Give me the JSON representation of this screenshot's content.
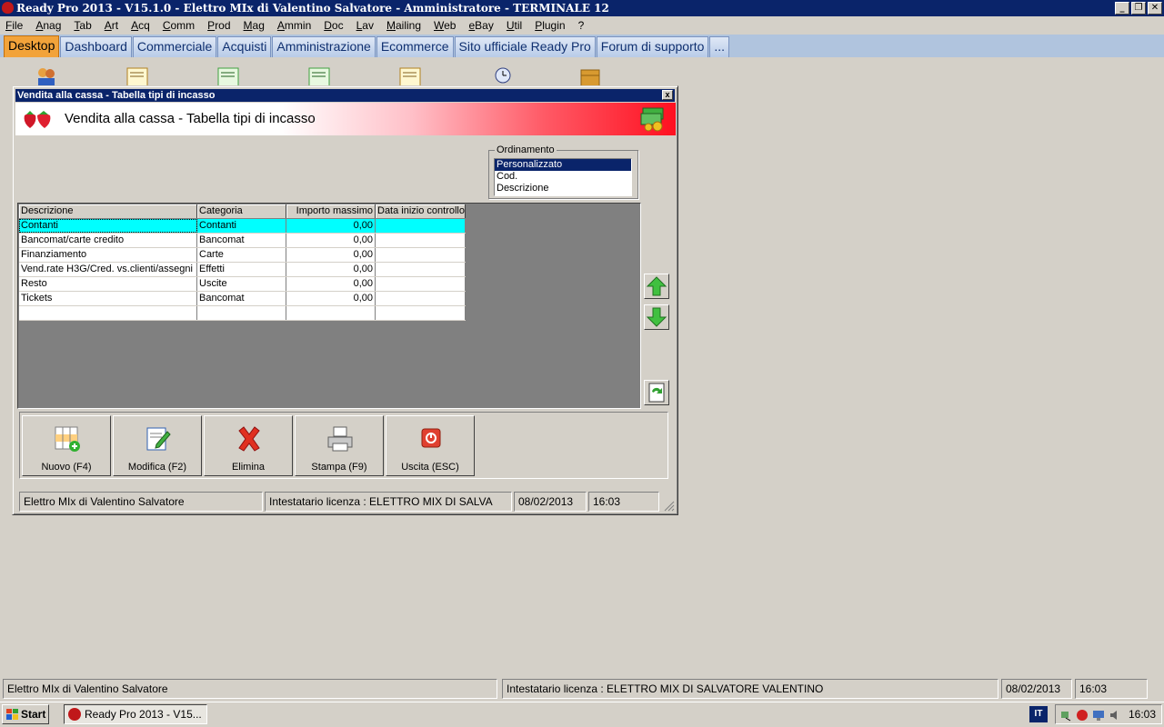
{
  "app": {
    "title": "Ready Pro 2013 - V15.1.0 - Elettro MIx di Valentino Salvatore - Amministratore - TERMINALE 12",
    "win_min": "_",
    "win_restore": "❐",
    "win_close": "✕"
  },
  "menu": [
    "File",
    "Anag",
    "Tab",
    "Art",
    "Acq",
    "Comm",
    "Prod",
    "Mag",
    "Ammin",
    "Doc",
    "Lav",
    "Mailing",
    "Web",
    "eBay",
    "Util",
    "Plugin",
    "?"
  ],
  "tabs": [
    {
      "label": "Desktop",
      "active": true
    },
    {
      "label": "Dashboard"
    },
    {
      "label": "Commerciale"
    },
    {
      "label": "Acquisti"
    },
    {
      "label": "Amministrazione"
    },
    {
      "label": "Ecommerce"
    },
    {
      "label": "Sito ufficiale Ready Pro"
    },
    {
      "label": "Forum di supporto"
    },
    {
      "label": "..."
    }
  ],
  "window": {
    "title": "Vendita alla cassa - Tabella tipi di incasso",
    "close": "x",
    "banner_title": "Vendita alla cassa - Tabella tipi di incasso"
  },
  "sort": {
    "legend": "Ordinamento",
    "options": [
      "Personalizzato",
      "Cod.",
      "Descrizione"
    ],
    "selected": 0
  },
  "grid": {
    "columns": [
      "Descrizione",
      "Categoria",
      "Importo massimo",
      "Data inizio controllo"
    ],
    "rows": [
      [
        "Contanti",
        "Contanti",
        "0,00",
        ""
      ],
      [
        "Bancomat/carte credito",
        "Bancomat",
        "0,00",
        ""
      ],
      [
        "Finanziamento",
        "Carte",
        "0,00",
        ""
      ],
      [
        "Vend.rate H3G/Cred. vs.clienti/assegni",
        "Effetti",
        "0,00",
        ""
      ],
      [
        "Resto",
        "Uscite",
        "0,00",
        ""
      ],
      [
        "Tickets",
        "Bancomat",
        "0,00",
        ""
      ],
      [
        "",
        "",
        "",
        ""
      ]
    ]
  },
  "toolbar": {
    "new": "Nuovo (F4)",
    "edit": "Modifica (F2)",
    "delete": "Elimina",
    "print": "Stampa (F9)",
    "exit": "Uscita (ESC)"
  },
  "child_status": {
    "company": "Elettro MIx di Valentino Salvatore",
    "license": "Intestatario licenza : ELETTRO MIX DI SALVA",
    "date": "08/02/2013",
    "time": "16:03"
  },
  "main_status": {
    "company": "Elettro MIx di Valentino Salvatore",
    "license": "Intestatario licenza : ELETTRO MIX DI SALVATORE VALENTINO",
    "date": "08/02/2013",
    "time": "16:03"
  },
  "taskbar": {
    "start": "Start",
    "task": "Ready Pro 2013 - V15...",
    "lang": "IT",
    "clock": "16:03"
  }
}
